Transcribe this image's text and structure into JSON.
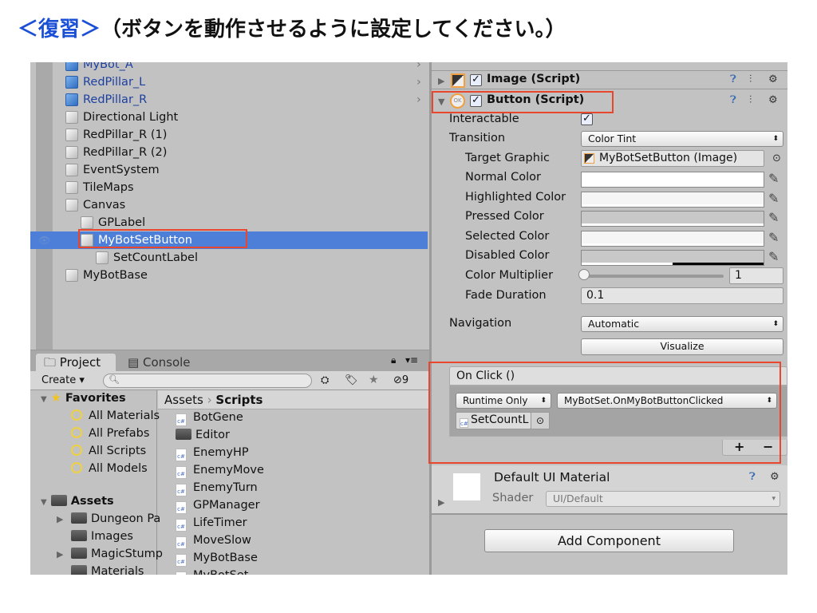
{
  "slide_title": {
    "bracket": "＜復習＞",
    "text": "（ボタンを動作させるように設定してください。）"
  },
  "hierarchy": {
    "items": [
      {
        "label": "MyBot_A",
        "prefab": true,
        "expand": "collapsed"
      },
      {
        "label": "RedPillar_L",
        "prefab": true
      },
      {
        "label": "RedPillar_R",
        "prefab": true
      },
      {
        "label": "Directional Light"
      },
      {
        "label": "RedPillar_R (1)"
      },
      {
        "label": "RedPillar_R (2)"
      },
      {
        "label": "EventSystem"
      },
      {
        "label": "TileMaps",
        "expand": "collapsed"
      },
      {
        "label": "Canvas",
        "expand": "expanded"
      },
      {
        "label": "GPLabel"
      },
      {
        "label": "MyBotSetButton",
        "expand": "expanded",
        "selected": true
      },
      {
        "label": "SetCountLabel"
      },
      {
        "label": "MyBotBase"
      }
    ]
  },
  "project": {
    "tabs": [
      "Project",
      "Console"
    ],
    "create": "Create",
    "hidden_count": "9",
    "favorites": {
      "title": "Favorites",
      "items": [
        "All Materials",
        "All Prefabs",
        "All Scripts",
        "All Models"
      ]
    },
    "assets": {
      "title": "Assets",
      "items": [
        "Dungeon Pa",
        "Images",
        "MagicStump",
        "Materials"
      ]
    },
    "breadcrumb": [
      "Assets",
      "Scripts"
    ],
    "files": [
      {
        "name": "BotGene",
        "type": "script"
      },
      {
        "name": "Editor",
        "type": "folder"
      },
      {
        "name": "EnemyHP",
        "type": "script"
      },
      {
        "name": "EnemyMove",
        "type": "script"
      },
      {
        "name": "EnemyTurn",
        "type": "script"
      },
      {
        "name": "GPManager",
        "type": "script"
      },
      {
        "name": "LifeTimer",
        "type": "script"
      },
      {
        "name": "MoveSlow",
        "type": "script"
      },
      {
        "name": "MyBotBase",
        "type": "script"
      },
      {
        "name": "MyBotSet",
        "type": "script"
      }
    ]
  },
  "inspector": {
    "image_component": "Image (Script)",
    "button_component": "Button (Script)",
    "interactable": {
      "label": "Interactable",
      "checked": true
    },
    "transition": {
      "label": "Transition",
      "value": "Color Tint"
    },
    "target_graphic": {
      "label": "Target Graphic",
      "value": "MyBotSetButton (Image)"
    },
    "colors": [
      {
        "label": "Normal Color",
        "color": "#ffffff"
      },
      {
        "label": "Highlighted Color",
        "color": "#f5f5f5"
      },
      {
        "label": "Pressed Color",
        "color": "#c8c8c8"
      },
      {
        "label": "Selected Color",
        "color": "#f5f5f5"
      },
      {
        "label": "Disabled Color",
        "color": "#c8c8c8"
      }
    ],
    "color_multiplier": {
      "label": "Color Multiplier",
      "value": "1"
    },
    "fade_duration": {
      "label": "Fade Duration",
      "value": "0.1"
    },
    "navigation": {
      "label": "Navigation",
      "value": "Automatic"
    },
    "visualize": "Visualize",
    "on_click": {
      "title": "On Click ()",
      "mode": "Runtime Only",
      "function": "MyBotSet.OnMyBotButtonClicked",
      "target": "SetCountL",
      "add": "+",
      "remove": "−"
    },
    "material": {
      "name": "Default UI Material",
      "shader_label": "Shader",
      "shader": "UI/Default"
    },
    "add_component": "Add Component"
  }
}
